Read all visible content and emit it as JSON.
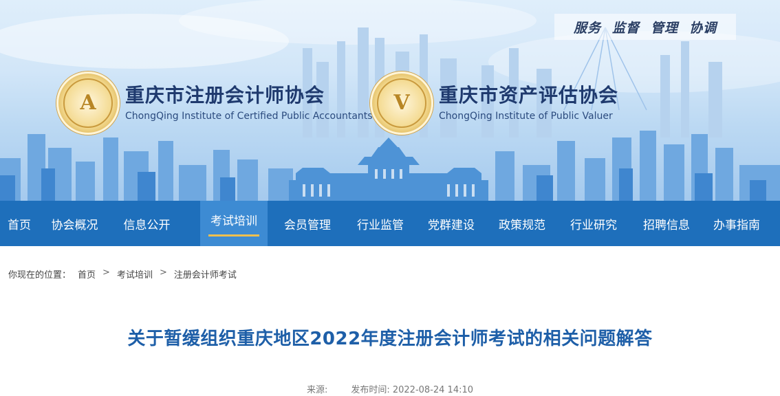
{
  "header": {
    "slogan": [
      "服务",
      "监督",
      "管理",
      "协调"
    ],
    "org1": {
      "name_cn": "重庆市注册会计师协会",
      "name_en": "ChongQing Institute of Certified Public Accountants",
      "seal_letter": "A"
    },
    "org2": {
      "name_cn": "重庆市资产评估协会",
      "name_en": "ChongQing Institute of Public Valuer",
      "seal_letter": "V"
    }
  },
  "nav": {
    "items": [
      {
        "label": "首页",
        "active": false
      },
      {
        "label": "协会概况",
        "active": false
      },
      {
        "label": "信息公开",
        "active": false
      },
      {
        "label": "考试培训",
        "active": true
      },
      {
        "label": "会员管理",
        "active": false
      },
      {
        "label": "行业监管",
        "active": false
      },
      {
        "label": "党群建设",
        "active": false
      },
      {
        "label": "政策规范",
        "active": false
      },
      {
        "label": "行业研究",
        "active": false
      },
      {
        "label": "招聘信息",
        "active": false
      },
      {
        "label": "办事指南",
        "active": false
      }
    ]
  },
  "breadcrumb": {
    "prefix": "你现在的位置：",
    "items": [
      "首页",
      "考试培训",
      "注册会计师考试"
    ],
    "separator": ">"
  },
  "article": {
    "title": "关于暂缓组织重庆地区2022年度注册会计师考试的相关问题解答",
    "source_label": "来源:",
    "date_label": "发布时间: 2022-08-24 14:10"
  },
  "colors": {
    "nav_bg": "#1e6fbb",
    "nav_active": "#3d8bd3",
    "active_underline": "#f3c04e",
    "title": "#1e5fa8"
  }
}
